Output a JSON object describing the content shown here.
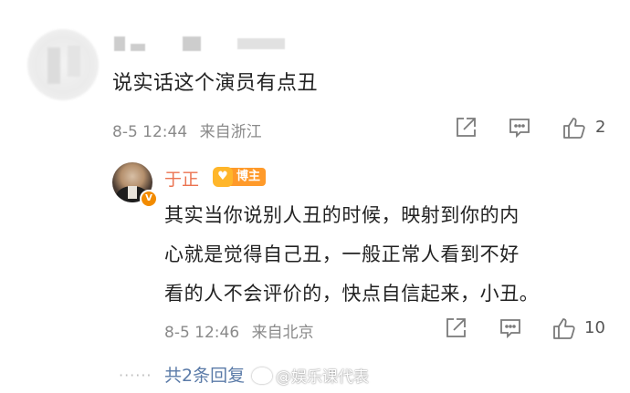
{
  "top_comment": {
    "text": "说实话这个演员有点丑",
    "time": "8-5 12:44",
    "location": "来自浙江",
    "like_count": "2"
  },
  "reply": {
    "user_name": "于正",
    "badge_label": "博主",
    "badge_icon": "heart-icon",
    "verified_badge": "V",
    "text_lines": [
      "其实当你说别人丑的时候，映射到你的内",
      "心就是觉得自己丑，一般正常人看到不好",
      "看的人不会评价的，快点自信起来，小丑。"
    ],
    "time": "8-5 12:46",
    "location": "来自北京",
    "like_count": "10"
  },
  "more_replies": {
    "dots": "······",
    "label": "共2条回复"
  },
  "watermark": "@娱乐课代表",
  "colors": {
    "username": "#eb7350",
    "link": "#5b7ba8",
    "meta": "#8a8a8a",
    "badge": "#ff9a2a"
  }
}
